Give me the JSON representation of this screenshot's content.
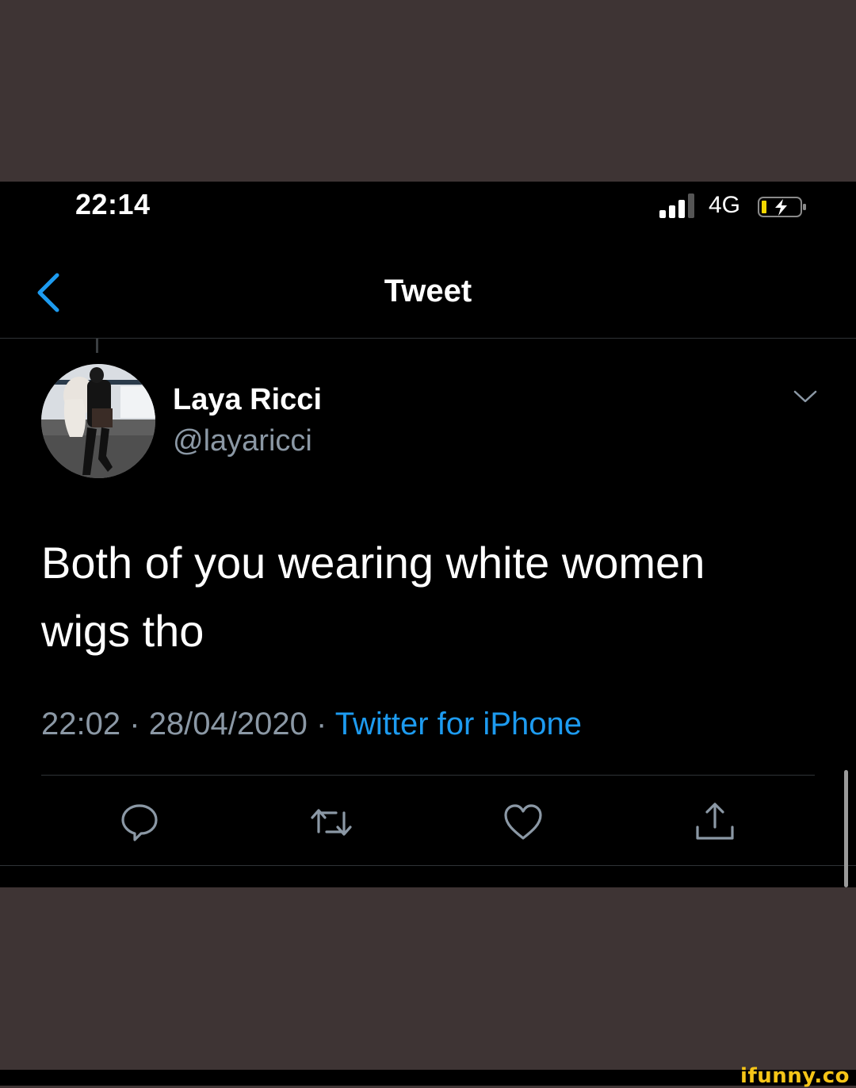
{
  "status_bar": {
    "time": "22:14",
    "network": "4G"
  },
  "nav": {
    "title": "Tweet"
  },
  "tweet": {
    "author_name": "Laya Ricci",
    "author_handle": "@layaricci",
    "text": "Both of you wearing white women wigs tho",
    "time": "22:02",
    "separator": "·",
    "date": "28/04/2020",
    "source": "Twitter for iPhone"
  },
  "actions": [
    "reply-icon",
    "retweet-icon",
    "like-icon",
    "share-icon"
  ],
  "watermark": "ifunny.co",
  "colors": {
    "accent": "#1d9bf0",
    "secondary_text": "#8b98a5",
    "background": "#000000",
    "outer": "#3e3434"
  }
}
